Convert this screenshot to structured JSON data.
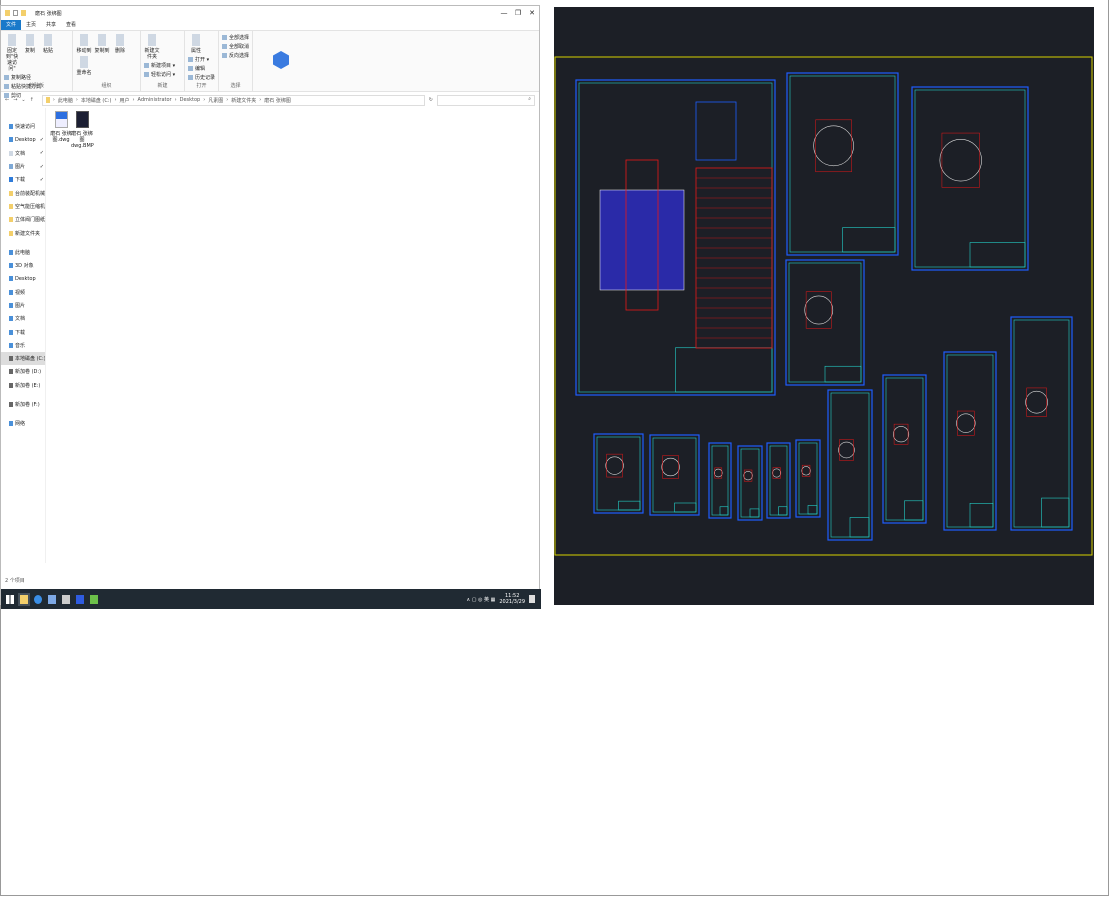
{
  "window": {
    "title": "磨石 张绑图",
    "controls": [
      "—",
      "❐",
      "✕"
    ]
  },
  "tabs": [
    "文件",
    "主页",
    "共享",
    "查看"
  ],
  "ribbon": {
    "groups": [
      {
        "label": "剪贴板",
        "big": [
          "固定到\"快速访问\"",
          "复制",
          "粘贴"
        ],
        "small": [
          "复制路径",
          "粘贴快捷方式",
          "剪切"
        ]
      },
      {
        "label": "组织",
        "big": [
          "移动到",
          "复制到",
          "删除",
          "重命名"
        ],
        "small": []
      },
      {
        "label": "新建",
        "big": [
          "新建文件夹"
        ],
        "small": [
          "新建项目 ▾",
          "轻松访问 ▾"
        ]
      },
      {
        "label": "打开",
        "big": [
          "属性"
        ],
        "small": [
          "打开 ▾",
          "编辑",
          "历史记录"
        ]
      },
      {
        "label": "选择",
        "big": [],
        "small": [
          "全部选择",
          "全部取消",
          "反向选择"
        ]
      }
    ]
  },
  "address": {
    "crumbs": [
      "此电脑",
      "本地磁盘 (C:)",
      "用户",
      "Administrator",
      "Desktop",
      "凡素图",
      "新建文件夹",
      "磨石 张绑图"
    ],
    "search_placeholder": "⌕"
  },
  "sidebar": {
    "items": [
      {
        "label": "快速访问",
        "type": "star"
      },
      {
        "label": "Desktop",
        "type": "pc",
        "pin": true
      },
      {
        "label": "文档",
        "type": "doc",
        "pin": true
      },
      {
        "label": "图片",
        "type": "pic",
        "pin": true
      },
      {
        "label": "下载",
        "type": "down",
        "pin": true
      },
      {
        "label": "台前装配机械图",
        "type": "folder"
      },
      {
        "label": "空气能压缩机图",
        "type": "folder"
      },
      {
        "label": "立体阀门图纸",
        "type": "folder"
      },
      {
        "label": "新建文件夹",
        "type": "folder"
      },
      {
        "label": "此电脑",
        "type": "pc",
        "gap": true
      },
      {
        "label": "3D 对象",
        "type": "pc"
      },
      {
        "label": "Desktop",
        "type": "pc"
      },
      {
        "label": "视频",
        "type": "pc"
      },
      {
        "label": "图片",
        "type": "pc"
      },
      {
        "label": "文档",
        "type": "pc"
      },
      {
        "label": "下载",
        "type": "pc"
      },
      {
        "label": "音乐",
        "type": "pc"
      },
      {
        "label": "本地磁盘 (C:)",
        "type": "drive",
        "selected": true
      },
      {
        "label": "新加卷 (D:)",
        "type": "drive"
      },
      {
        "label": "新加卷 (E:)",
        "type": "drive"
      },
      {
        "label": "新加卷 (F:)",
        "type": "drive",
        "gap": true
      },
      {
        "label": "网络",
        "type": "net",
        "gap": true
      }
    ]
  },
  "files": [
    {
      "name": "磨石 张绑图.dwg",
      "icon": "dwg-file-icon"
    },
    {
      "name": "磨石 张绑图 dwg.BMP",
      "icon": "bmp-file-icon"
    }
  ],
  "status": "2 个项目",
  "taskbar": {
    "tray": "∧ ▢ ◎ 英 ▦",
    "time": "11:52",
    "date": "2021/3/29"
  },
  "colors": {
    "cad_bg": "#1c1f26",
    "frame": "#d6d000",
    "sheet": "#1e5dff",
    "line": "#24d0c8",
    "red": "#e81818",
    "blue_fill": "#2a2aa8",
    "accent": "#1979ca"
  }
}
